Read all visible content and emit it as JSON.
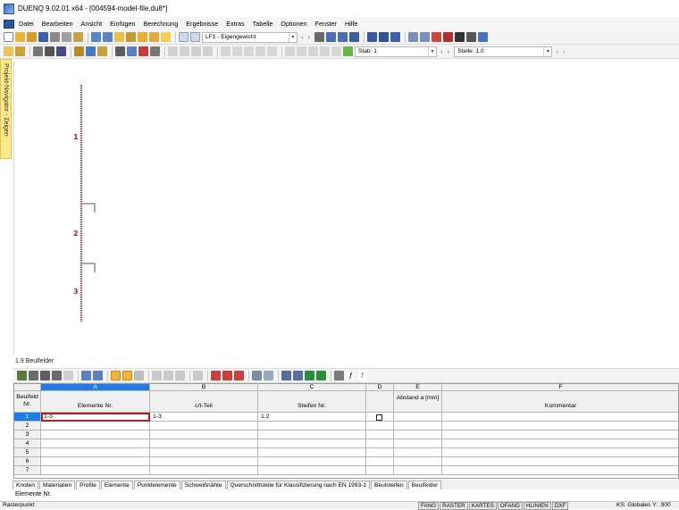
{
  "window": {
    "title": "DUENQ 9.02.01 x64 - [004594-model-file.du8*]"
  },
  "menu": [
    "Datei",
    "Bearbeiten",
    "Ansicht",
    "Einfügen",
    "Berechnung",
    "Ergebnisse",
    "Extras",
    "Tabelle",
    "Optionen",
    "Fenster",
    "Hilfe"
  ],
  "toolbar1": {
    "loadcase": "LF1 - Eigengewicht"
  },
  "toolbar2": {
    "stab_label": "Stab: 1",
    "stelle_label": "Stelle: 1.0"
  },
  "side_tab": "Projekt-Navigator - Zeigen",
  "canvas": {
    "element_labels": [
      "1",
      "2",
      "3"
    ],
    "element_color": "#d01010"
  },
  "panel": {
    "title": "1.9 Beulfelder"
  },
  "table": {
    "rowhead_title": "Beulfeld Nr.",
    "col_letters": [
      "A",
      "B",
      "C",
      "D",
      "E",
      "F"
    ],
    "col_titles": [
      "Elemente Nr.",
      "c/t-Teil",
      "Steifen Nr.",
      "",
      "Abstand a [mm]",
      "Kommentar"
    ],
    "row_numbers": [
      "1",
      "2",
      "3",
      "4",
      "5",
      "6",
      "7"
    ],
    "row1": {
      "elements": "1-3",
      "ct_teil": "1-3",
      "steifen": "1.2",
      "abstand": "",
      "kommentar": ""
    }
  },
  "tabs": [
    "Knoten",
    "Materialien",
    "Profile",
    "Elemente",
    "Punktelemente",
    "Schweißnähte",
    "Querschnittsteile für Klassifizierung nach EN 1993-1",
    "Beulsteifen",
    "Beulfelder"
  ],
  "active_tab": "Beulfelder",
  "info_text": "Elemente Nr.",
  "status": {
    "left": "Rasterpunkt",
    "toggles": [
      "FANG",
      "RASTER",
      "KARTES",
      "OFANG",
      "HLINIEN",
      "DXF"
    ],
    "right": "KS: Globales  Y: .900"
  }
}
